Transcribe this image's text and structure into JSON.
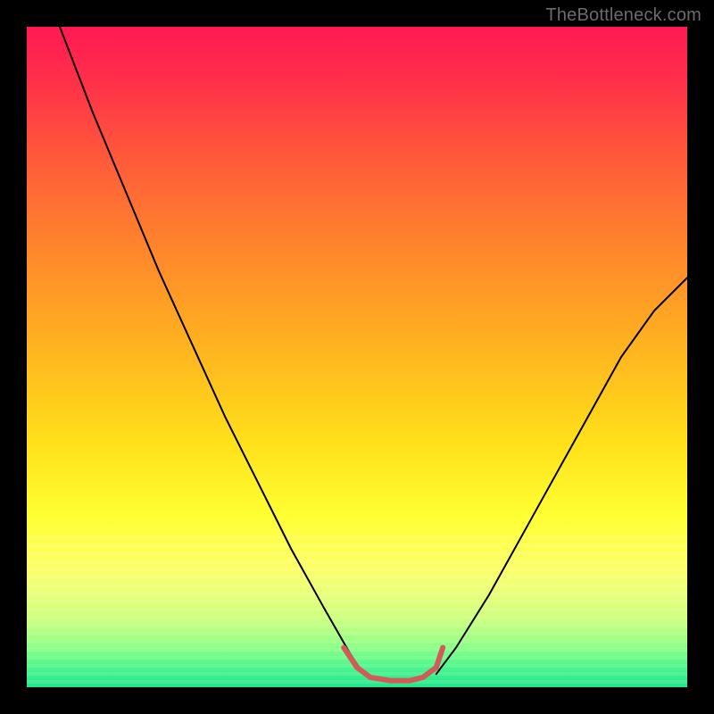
{
  "watermark": {
    "text": "TheBottleneck.com"
  },
  "chart_data": {
    "type": "line",
    "title": "",
    "xlabel": "",
    "ylabel": "",
    "xlim": [
      0,
      100
    ],
    "ylim": [
      0,
      100
    ],
    "grid": false,
    "legend": false,
    "gradient_stops": [
      {
        "pos": 0,
        "color": "#ff1a53"
      },
      {
        "pos": 8,
        "color": "#ff2f4a"
      },
      {
        "pos": 20,
        "color": "#ff5a3a"
      },
      {
        "pos": 35,
        "color": "#ff8a2a"
      },
      {
        "pos": 50,
        "color": "#ffb81f"
      },
      {
        "pos": 63,
        "color": "#ffe01a"
      },
      {
        "pos": 74,
        "color": "#ffff33"
      },
      {
        "pos": 82,
        "color": "#fcff66"
      },
      {
        "pos": 86,
        "color": "#e8ff7a"
      },
      {
        "pos": 90,
        "color": "#c8ff80"
      },
      {
        "pos": 94,
        "color": "#8cff88"
      },
      {
        "pos": 97,
        "color": "#4cf58c"
      },
      {
        "pos": 100,
        "color": "#22e68c"
      }
    ],
    "series": [
      {
        "name": "left_black_curve",
        "color": "#000000",
        "width": 2,
        "x": [
          5,
          10,
          15,
          20,
          25,
          30,
          35,
          40,
          45,
          49,
          51
        ],
        "y": [
          100,
          87,
          75,
          63,
          52,
          41,
          31,
          21,
          12,
          5,
          2
        ]
      },
      {
        "name": "right_black_curve",
        "color": "#000000",
        "width": 2,
        "x": [
          62,
          65,
          70,
          75,
          80,
          85,
          90,
          95,
          100
        ],
        "y": [
          2,
          6,
          14,
          23,
          32,
          41,
          50,
          57,
          62
        ]
      },
      {
        "name": "red_trough",
        "color": "#d45a5a",
        "width": 6,
        "x": [
          48,
          50,
          52,
          55,
          58,
          60,
          62,
          63
        ],
        "y": [
          6,
          3,
          1.5,
          1,
          1,
          1.5,
          3,
          6
        ]
      }
    ]
  }
}
